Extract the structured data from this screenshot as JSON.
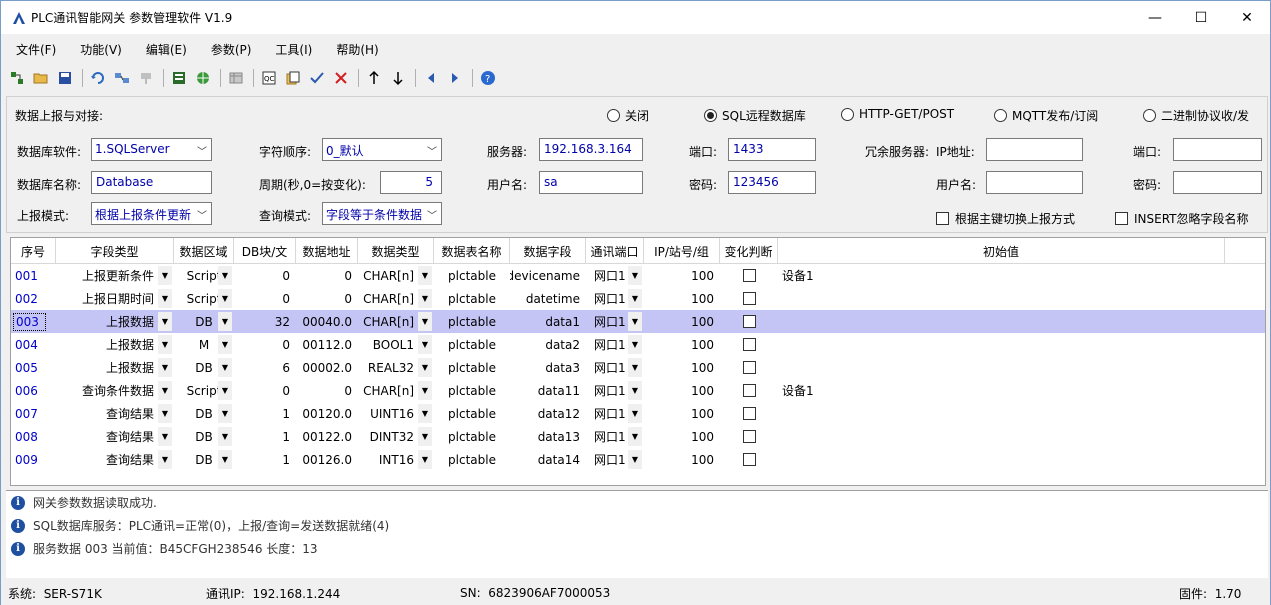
{
  "window": {
    "title": "PLC通讯智能网关 参数管理软件 V1.9",
    "minimize": "—",
    "maximize": "☐",
    "close": "✕"
  },
  "menu": [
    "文件(F)",
    "功能(V)",
    "编辑(E)",
    "参数(P)",
    "工具(I)",
    "帮助(H)"
  ],
  "toolbar": {
    "icons": [
      "network-config-icon",
      "open-folder-icon",
      "save-icon",
      "refresh-icon",
      "connect-icon",
      "disconnect-icon",
      "read-icon",
      "web-icon",
      "table-icon",
      "qc-icon",
      "copy-icon",
      "check-icon",
      "delete-icon",
      "up-arrow-icon",
      "down-arrow-icon",
      "left-arrow-icon",
      "right-arrow-icon",
      "help-icon"
    ]
  },
  "report": {
    "label": "数据上报与对接:",
    "modes": [
      {
        "label": "关闭",
        "selected": false
      },
      {
        "label": "SQL远程数据库",
        "selected": true
      },
      {
        "label": "HTTP-GET/POST",
        "selected": false
      },
      {
        "label": "MQTT发布/订阅",
        "selected": false
      },
      {
        "label": "二进制协议收/发",
        "selected": false
      }
    ],
    "db_software_label": "数据库软件:",
    "db_software": "1.SQLServer",
    "byte_order_label": "字符顺序:",
    "byte_order": "0_默认",
    "server_label": "服务器:",
    "server": "192.168.3.164",
    "port_label": "端口:",
    "port": "1433",
    "redundant_label": "冗余服务器:",
    "ip_label": "IP地址:",
    "redundant_ip": "",
    "redundant_port_label": "端口:",
    "redundant_port": "",
    "db_name_label": "数据库名称:",
    "db_name": "Database",
    "period_label": "周期(秒,0=按变化):",
    "period": "5",
    "user_label": "用户名:",
    "user": "sa",
    "pwd_label": "密码:",
    "pwd": "123456",
    "redundant_user_label": "用户名:",
    "redundant_user": "",
    "redundant_pwd_label": "密码:",
    "redundant_pwd": "",
    "report_mode_label": "上报模式:",
    "report_mode": "根据上报条件更新",
    "query_mode_label": "查询模式:",
    "query_mode": "字段等于条件数据",
    "key_switch_label": "根据主键切换上报方式",
    "key_switch": false,
    "insert_ignore_label": "INSERT忽略字段名称",
    "insert_ignore": false
  },
  "table": {
    "headers": [
      "序号",
      "字段类型",
      "数据区域",
      "DB块/文",
      "数据地址",
      "数据类型",
      "数据表名称",
      "数据字段",
      "通讯端口",
      "IP/站号/组",
      "变化判断",
      "初始值"
    ],
    "rows": [
      [
        "001",
        "上报更新条件",
        "Script",
        "0",
        "0",
        "CHAR[n]",
        "plctable",
        "devicename",
        "网口1",
        "100",
        false,
        "设备1"
      ],
      [
        "002",
        "上报日期时间",
        "Script",
        "0",
        "0",
        "CHAR[n]",
        "plctable",
        "datetime",
        "网口1",
        "100",
        false,
        ""
      ],
      [
        "003",
        "上报数据",
        "DB",
        "32",
        "00040.0",
        "CHAR[n]",
        "plctable",
        "data1",
        "网口1",
        "100",
        false,
        ""
      ],
      [
        "004",
        "上报数据",
        "M",
        "0",
        "00112.0",
        "BOOL1",
        "plctable",
        "data2",
        "网口1",
        "100",
        false,
        ""
      ],
      [
        "005",
        "上报数据",
        "DB",
        "6",
        "00002.0",
        "REAL32",
        "plctable",
        "data3",
        "网口1",
        "100",
        false,
        ""
      ],
      [
        "006",
        "查询条件数据",
        "Script",
        "0",
        "0",
        "CHAR[n]",
        "plctable",
        "data11",
        "网口1",
        "100",
        false,
        "设备1"
      ],
      [
        "007",
        "查询结果",
        "DB",
        "1",
        "00120.0",
        "UINT16",
        "plctable",
        "data12",
        "网口1",
        "100",
        false,
        ""
      ],
      [
        "008",
        "查询结果",
        "DB",
        "1",
        "00122.0",
        "DINT32",
        "plctable",
        "data13",
        "网口1",
        "100",
        false,
        ""
      ],
      [
        "009",
        "查询结果",
        "DB",
        "1",
        "00126.0",
        "INT16",
        "plctable",
        "data14",
        "网口1",
        "100",
        false,
        ""
      ]
    ],
    "selected_row": "003"
  },
  "log": [
    "网关参数数据读取成功.",
    "SQL数据库服务：PLC通讯=正常(0)，上报/查询=发送数据就绪(4)",
    "服务数据 003 当前值：B45CFGH238546  长度：13"
  ],
  "status": {
    "system_label": "系统:",
    "system": "SER-S71K",
    "ip_label": "通讯IP:",
    "ip": "192.168.1.244",
    "sn_label": "SN:",
    "sn": "6823906AF7000053",
    "fw_label": "固件:",
    "fw": "1.70"
  },
  "colors": {
    "selected_row": "#c4c4f5",
    "link_blue": "#0000cc",
    "accent": "#1e4fa0"
  }
}
